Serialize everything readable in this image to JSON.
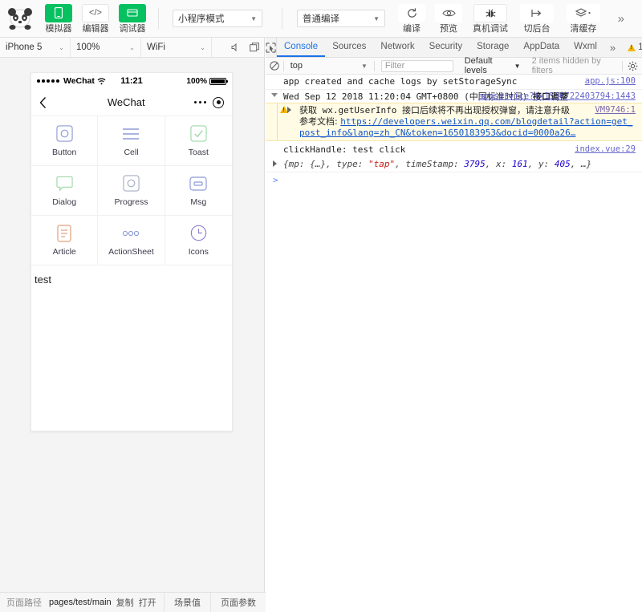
{
  "toolbar": {
    "logo_name": "wechat-devtools-panda-logo",
    "left_buttons": [
      {
        "label": "模拟器",
        "icon": "phone-icon",
        "style": "green"
      },
      {
        "label": "编辑器",
        "icon": "code-icon",
        "style": "white"
      },
      {
        "label": "调试器",
        "icon": "debugger-icon",
        "style": "green"
      }
    ],
    "mode_select": {
      "value": "小程序模式",
      "caret": "▼"
    },
    "compile_select": {
      "value": "普通编译",
      "caret": "▼"
    },
    "actions": [
      {
        "label": "编译",
        "icon": "refresh-icon"
      },
      {
        "label": "预览",
        "icon": "eye-icon"
      },
      {
        "label": "真机调试",
        "icon": "bug-icon"
      },
      {
        "label": "切后台",
        "icon": "background-icon"
      },
      {
        "label": "清缓存",
        "icon": "layers-icon"
      }
    ],
    "overflow": "»"
  },
  "simulator": {
    "device_select": {
      "value": "iPhone 5",
      "caret": "⌄"
    },
    "zoom_select": {
      "value": "100%",
      "caret": "⌄"
    },
    "network_select": {
      "value": "WiFi",
      "caret": "⌄"
    },
    "mute_icon": "speaker-mute-icon",
    "window_icon": "detach-window-icon",
    "phone": {
      "statusbar": {
        "carrier": "WeChat",
        "signal_dots": 5,
        "wifi_icon": "wifi-icon",
        "time": "11:21",
        "battery_percent": "100%"
      },
      "navbar": {
        "back_icon": "back-chevron-icon",
        "title": "WeChat",
        "menu_icon": "more-dots-icon",
        "target_icon": "target-circle-icon"
      },
      "grid": [
        {
          "label": "Button",
          "icon": "square-circle-icon",
          "color": "#8f9bd6"
        },
        {
          "label": "Cell",
          "icon": "lines-icon",
          "color": "#8f9bd6"
        },
        {
          "label": "Toast",
          "icon": "check-square-icon",
          "color": "#9ed9a8"
        },
        {
          "label": "Dialog",
          "icon": "chat-bubble-icon",
          "color": "#9ed9a8"
        },
        {
          "label": "Progress",
          "icon": "square-circle-icon",
          "color": "#a6aec4"
        },
        {
          "label": "Msg",
          "icon": "message-card-icon",
          "color": "#8f9bd6"
        },
        {
          "label": "Article",
          "icon": "document-icon",
          "color": "#e0a07a"
        },
        {
          "label": "ActionSheet",
          "icon": "three-dots-icon",
          "color": "#8f9bd6"
        },
        {
          "label": "Icons",
          "icon": "clock-icon",
          "color": "#8f7fd0"
        }
      ],
      "body_text": "test"
    }
  },
  "devtools": {
    "inspect_icon": "inspect-element-icon",
    "tabs": [
      {
        "label": "Console",
        "active": true
      },
      {
        "label": "Sources",
        "active": false
      },
      {
        "label": "Network",
        "active": false
      },
      {
        "label": "Security",
        "active": false
      },
      {
        "label": "Storage",
        "active": false
      },
      {
        "label": "AppData",
        "active": false
      },
      {
        "label": "Wxml",
        "active": false
      }
    ],
    "tabs_overflow": "»",
    "warning_count": "1",
    "kebab_icon": "more-vertical-icon",
    "dock_icon": "dock-side-icon",
    "filterbar": {
      "clear_icon": "clear-console-icon",
      "context": {
        "value": "top",
        "caret": "▼"
      },
      "filter_placeholder": "Filter",
      "filter_value": "",
      "levels": {
        "value": "Default levels",
        "caret": "▼"
      },
      "hidden_text": "2 items hidden by filters",
      "settings_icon": "gear-icon"
    },
    "console": {
      "messages": [
        {
          "kind": "log",
          "text": "app created and cache logs by setStorageSync",
          "source": "app.js:100"
        },
        {
          "kind": "group",
          "text_mono": "Wed Sep 12 2018 11:20:04 GMT+0800 (",
          "text_cjk": "中国标准时间",
          "text_mono2": ") ",
          "text_cjk2": "接口调整",
          "source": "appservice?t=1536722403794:1443"
        },
        {
          "kind": "warning",
          "text_cjk": "获取",
          "text_mono": " wx.getUserInfo ",
          "text_cjk2": "接口后续将不再出现授权弹窗，请注意升级",
          "doc_label": "参考文档: ",
          "doc_url": "https://developers.weixin.qq.com/blogdetail?action=get_post_info&lang=zh_CN&token=1650183953&docid=0000a26…",
          "source": "VM9746:1"
        },
        {
          "kind": "log",
          "text": "clickHandle: test click",
          "source": "index.vue:29"
        },
        {
          "kind": "object",
          "prefix": "{mp: ",
          "mp_val": "{…}",
          "k_type": ", type: ",
          "v_type": "\"tap\"",
          "k_ts": ", timeStamp: ",
          "v_ts": "3795",
          "k_x": ", x: ",
          "v_x": "161",
          "k_y": ", y: ",
          "v_y": "405",
          "suffix": ", …}"
        }
      ],
      "prompt_symbol": ">"
    }
  },
  "footer": {
    "label": "页面路径",
    "path": "pages/test/main",
    "copy": "复制",
    "open": "打开",
    "scene_button": "场景值",
    "params_button": "页面参数"
  },
  "colors": {
    "brand_green": "#07c160",
    "accent_blue": "#1a73e8",
    "warning_yellow": "#f2b600",
    "warning_bg": "#fffbe5",
    "link_blue": "#1155cc"
  }
}
